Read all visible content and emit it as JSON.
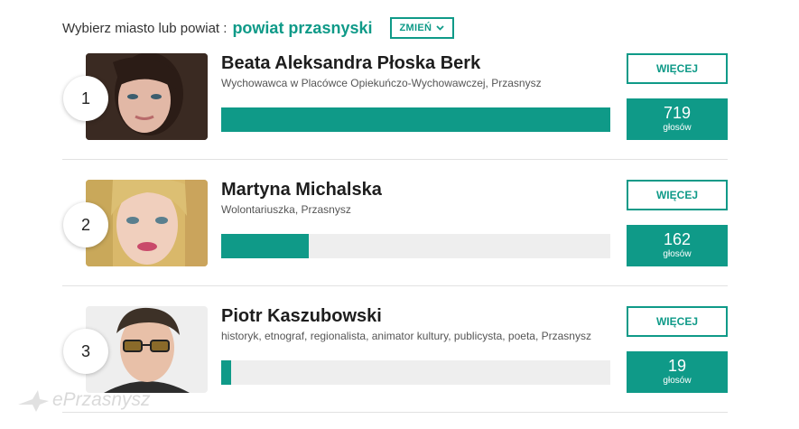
{
  "header": {
    "label": "Wybierz miasto lub powiat :",
    "city": "powiat przasnyski",
    "change_label": "ZMIEŃ"
  },
  "candidates": [
    {
      "rank": "1",
      "name": "Beata Aleksandra Płoska Berk",
      "description": "Wychowawca w Placówce Opiekuńczo-Wychowawczej, Przasnysz",
      "more_label": "WIĘCEJ",
      "votes": "719",
      "votes_unit": "głosów",
      "bar_fraction": 1.0
    },
    {
      "rank": "2",
      "name": "Martyna Michalska",
      "description": "Wolontariuszka, Przasnysz",
      "more_label": "WIĘCEJ",
      "votes": "162",
      "votes_unit": "głosów",
      "bar_fraction": 0.225
    },
    {
      "rank": "3",
      "name": "Piotr Kaszubowski",
      "description": "historyk, etnograf, regionalista, animator kultury, publicysta, poeta, Przasnysz",
      "more_label": "WIĘCEJ",
      "votes": "19",
      "votes_unit": "głosów",
      "bar_fraction": 0.026
    }
  ],
  "watermark": {
    "text": "ePrzasnysz"
  },
  "colors": {
    "accent": "#0f9a88",
    "bar_track": "#eeeeee"
  }
}
